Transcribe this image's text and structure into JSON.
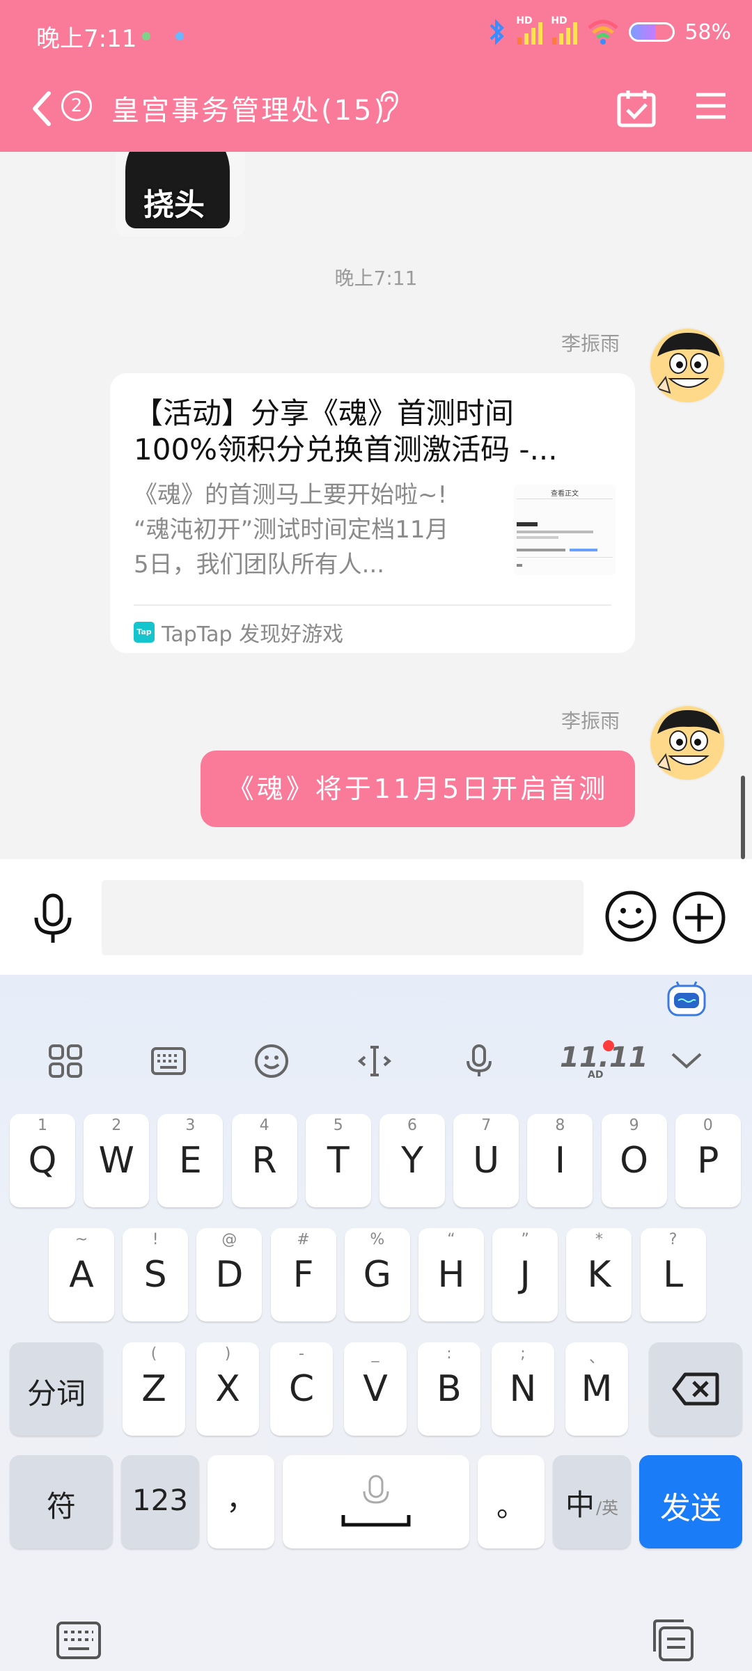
{
  "status_bar": {
    "time": "晚上7:11",
    "network_1": "HD",
    "network_2": "HD",
    "battery": "58%"
  },
  "header": {
    "unread_count": "2",
    "title": "皇宫事务管理处(15)"
  },
  "chat": {
    "timestamp": "晚上7:11",
    "sticker_text": "挠头",
    "messages": [
      {
        "sender": "李振雨",
        "type": "share-card",
        "title_line1": "【活动】分享《魂》首测时间",
        "title_line2": "100%领积分兑换首测激活码 -...",
        "desc_line1": "《魂》的首测马上要开始啦~!",
        "desc_line2": "“魂沌初开”测试时间定档11月",
        "desc_line3": "5日，我们团队所有人...",
        "thumb_heading": "查看正文",
        "source": "TapTap 发现好游戏",
        "source_icon": "Tap"
      },
      {
        "sender": "李振雨",
        "type": "text",
        "text": "《魂》将于11月5日开启首测"
      }
    ]
  },
  "input": {
    "placeholder": ""
  },
  "keyboard": {
    "toolbar_1111": "11.11",
    "toolbar_ad": "AD",
    "row1": [
      {
        "main": "Q",
        "sub": "1"
      },
      {
        "main": "W",
        "sub": "2"
      },
      {
        "main": "E",
        "sub": "3"
      },
      {
        "main": "R",
        "sub": "4"
      },
      {
        "main": "T",
        "sub": "5"
      },
      {
        "main": "Y",
        "sub": "6"
      },
      {
        "main": "U",
        "sub": "7"
      },
      {
        "main": "I",
        "sub": "8"
      },
      {
        "main": "O",
        "sub": "9"
      },
      {
        "main": "P",
        "sub": "0"
      }
    ],
    "row2": [
      {
        "main": "A",
        "sub": "~"
      },
      {
        "main": "S",
        "sub": "!"
      },
      {
        "main": "D",
        "sub": "@"
      },
      {
        "main": "F",
        "sub": "#"
      },
      {
        "main": "G",
        "sub": "%"
      },
      {
        "main": "H",
        "sub": "“"
      },
      {
        "main": "J",
        "sub": "”"
      },
      {
        "main": "K",
        "sub": "*"
      },
      {
        "main": "L",
        "sub": "?"
      }
    ],
    "row3_left": "分词",
    "row3": [
      {
        "main": "Z",
        "sub": "("
      },
      {
        "main": "X",
        "sub": ")"
      },
      {
        "main": "C",
        "sub": "-"
      },
      {
        "main": "V",
        "sub": "_"
      },
      {
        "main": "B",
        "sub": ":"
      },
      {
        "main": "N",
        "sub": ";"
      },
      {
        "main": "M",
        "sub": "、"
      }
    ],
    "symbol_key": "符",
    "num_key": "123",
    "comma_key": "，",
    "period_key": "。",
    "lang_key_main": "中",
    "lang_key_sub": "/英",
    "send_key": "发送"
  },
  "colors": {
    "brand_pink": "#f97b99",
    "send_blue": "#1a7cf7"
  }
}
